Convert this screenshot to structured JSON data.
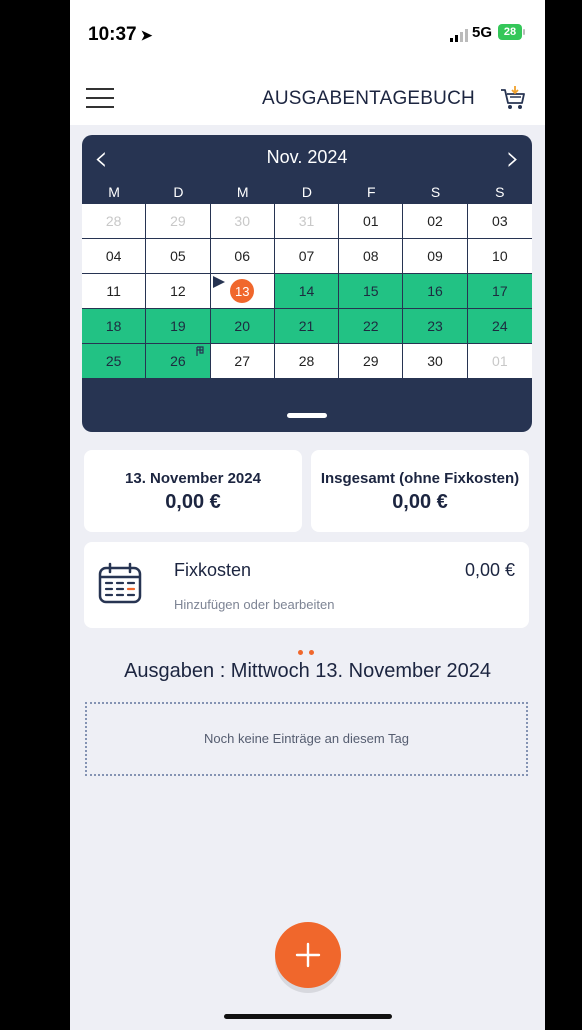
{
  "status_bar": {
    "time": "10:37",
    "network": "5G",
    "battery": "28"
  },
  "app": {
    "title": "AUSGABENTAGEBUCH"
  },
  "calendar": {
    "month_label": "Nov. 2024",
    "weekdays": [
      "M",
      "D",
      "M",
      "D",
      "F",
      "S",
      "S"
    ],
    "days": [
      {
        "label": "28",
        "state": "muted"
      },
      {
        "label": "29",
        "state": "muted"
      },
      {
        "label": "30",
        "state": "muted"
      },
      {
        "label": "31",
        "state": "muted"
      },
      {
        "label": "01",
        "state": "normal"
      },
      {
        "label": "02",
        "state": "normal"
      },
      {
        "label": "03",
        "state": "normal"
      },
      {
        "label": "04",
        "state": "normal"
      },
      {
        "label": "05",
        "state": "normal"
      },
      {
        "label": "06",
        "state": "normal"
      },
      {
        "label": "07",
        "state": "normal"
      },
      {
        "label": "08",
        "state": "normal"
      },
      {
        "label": "09",
        "state": "normal"
      },
      {
        "label": "10",
        "state": "normal"
      },
      {
        "label": "11",
        "state": "normal"
      },
      {
        "label": "12",
        "state": "normal"
      },
      {
        "label": "13",
        "state": "today",
        "marker": "start"
      },
      {
        "label": "14",
        "state": "green"
      },
      {
        "label": "15",
        "state": "green"
      },
      {
        "label": "16",
        "state": "green"
      },
      {
        "label": "17",
        "state": "green"
      },
      {
        "label": "18",
        "state": "green"
      },
      {
        "label": "19",
        "state": "green"
      },
      {
        "label": "20",
        "state": "green"
      },
      {
        "label": "21",
        "state": "green"
      },
      {
        "label": "22",
        "state": "green"
      },
      {
        "label": "23",
        "state": "green"
      },
      {
        "label": "24",
        "state": "green"
      },
      {
        "label": "25",
        "state": "green"
      },
      {
        "label": "26",
        "state": "green",
        "marker": "finish"
      },
      {
        "label": "27",
        "state": "normal"
      },
      {
        "label": "28",
        "state": "normal"
      },
      {
        "label": "29",
        "state": "normal"
      },
      {
        "label": "30",
        "state": "normal"
      },
      {
        "label": "01",
        "state": "muted"
      }
    ]
  },
  "summary": {
    "date_label": "13. November 2024",
    "date_value": "0,00 €",
    "total_label": "Insgesamt (ohne Fixkosten)",
    "total_value": "0,00 €"
  },
  "fixkosten": {
    "title": "Fixkosten",
    "subtitle": "Hinzufügen oder bearbeiten",
    "amount": "0,00 €"
  },
  "expenses": {
    "heading": "Ausgaben : Mittwoch 13. November 2024",
    "empty_text": "Noch keine Einträge an diesem Tag"
  },
  "colors": {
    "accent": "#f0672c",
    "navy": "#273452",
    "green": "#22c284"
  },
  "icons": [
    "menu-icon",
    "cart-icon",
    "chevron-left-icon",
    "chevron-right-icon",
    "calendar-icon",
    "plus-icon"
  ]
}
